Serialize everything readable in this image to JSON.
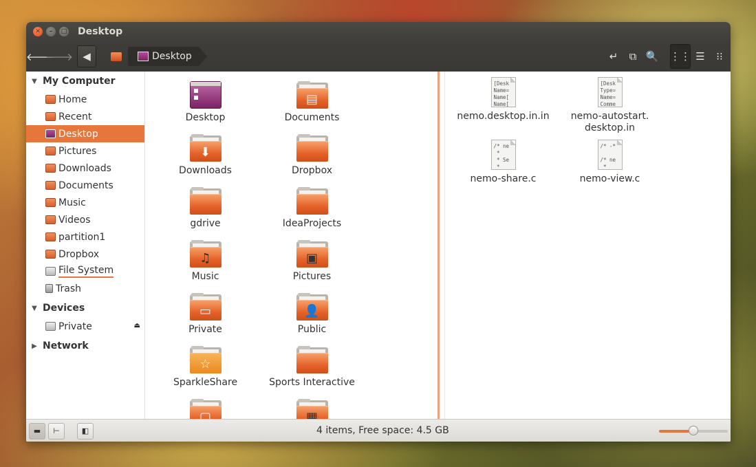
{
  "window": {
    "title": "Desktop"
  },
  "toolbar": {
    "breadcrumb": {
      "current": "Desktop"
    },
    "icons": [
      "back-arrow-icon",
      "forward-arrow-icon",
      "path-toggle-icon",
      "home-folder-icon",
      "open-terminal-icon",
      "split-view-icon",
      "search-icon",
      "icon-view-icon",
      "list-view-icon",
      "compact-view-icon"
    ]
  },
  "sidebar": {
    "sections": {
      "my_computer": "My Computer",
      "devices": "Devices",
      "network": "Network"
    },
    "items": [
      {
        "label": "Home",
        "icon": "home-folder-icon"
      },
      {
        "label": "Recent",
        "icon": "recent-icon"
      },
      {
        "label": "Desktop",
        "icon": "desktop-icon",
        "selected": true
      },
      {
        "label": "Pictures",
        "icon": "pictures-folder-icon"
      },
      {
        "label": "Downloads",
        "icon": "downloads-folder-icon"
      },
      {
        "label": "Documents",
        "icon": "documents-folder-icon"
      },
      {
        "label": "Music",
        "icon": "music-folder-icon"
      },
      {
        "label": "Videos",
        "icon": "videos-folder-icon"
      },
      {
        "label": "partition1",
        "icon": "folder-icon"
      },
      {
        "label": "Dropbox",
        "icon": "folder-icon"
      },
      {
        "label": "File System",
        "icon": "drive-icon"
      },
      {
        "label": "Trash",
        "icon": "trash-icon"
      }
    ],
    "devices": [
      {
        "label": "Private",
        "icon": "drive-icon"
      }
    ]
  },
  "left_pane": {
    "items": [
      {
        "label": "Desktop",
        "icon": "desktop-icon"
      },
      {
        "label": "Documents",
        "icon": "documents-folder-icon"
      },
      {
        "label": "Downloads",
        "icon": "downloads-folder-icon"
      },
      {
        "label": "Dropbox",
        "icon": "folder-icon"
      },
      {
        "label": "gdrive",
        "icon": "folder-icon"
      },
      {
        "label": "IdeaProjects",
        "icon": "folder-icon"
      },
      {
        "label": "Music",
        "icon": "music-folder-icon"
      },
      {
        "label": "Pictures",
        "icon": "pictures-folder-icon"
      },
      {
        "label": "Private",
        "icon": "drive-folder-icon"
      },
      {
        "label": "Public",
        "icon": "public-folder-icon"
      },
      {
        "label": "SparkleShare",
        "icon": "sparkleshare-folder-icon"
      },
      {
        "label": "Sports Interactive",
        "icon": "folder-icon"
      },
      {
        "label": "",
        "icon": "templates-folder-icon"
      },
      {
        "label": "",
        "icon": "videos-folder-icon"
      }
    ]
  },
  "right_pane": {
    "items": [
      {
        "label_line1": "nemo.desktop.in.in",
        "label_line2": "",
        "preview": "[Desk\nName=\nName[\nName["
      },
      {
        "label_line1": "nemo-autostart.",
        "label_line2": "desktop.in",
        "preview": "[Desk\nType=\nName=\nComme"
      },
      {
        "label_line1": "nemo-share.c",
        "label_line2": "",
        "preview": "/* ne\n *\n * Se\n *"
      },
      {
        "label_line1": "nemo-view.c",
        "label_line2": "",
        "preview": "/* -*\n\n/* ne\n *"
      }
    ]
  },
  "statusbar": {
    "text": "4 items, Free space: 4.5 GB",
    "zoom_fraction": 0.5
  }
}
